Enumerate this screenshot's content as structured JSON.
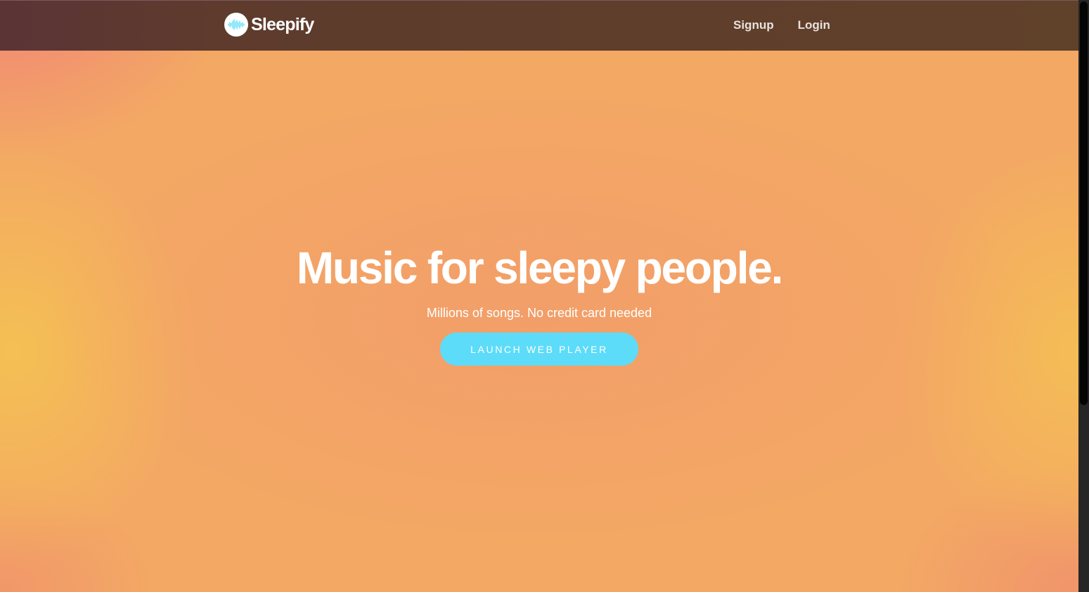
{
  "navbar": {
    "brand_name": "Sleepify",
    "links": [
      {
        "label": "Signup"
      },
      {
        "label": "Login"
      }
    ]
  },
  "hero": {
    "title": "Music for sleepy people.",
    "subtitle": "Millions of songs. No credit card needed",
    "cta_label": "LAUNCH WEB PLAYER"
  },
  "icons": {
    "logo": "soundwave-logo-icon"
  },
  "colors": {
    "navbar_bg": "#5e3b2d",
    "hero_bg": "#f3a864",
    "cta_bg": "#5cdcf9",
    "text": "#ffffff"
  },
  "scrollbar": {
    "position_fraction": 0
  }
}
